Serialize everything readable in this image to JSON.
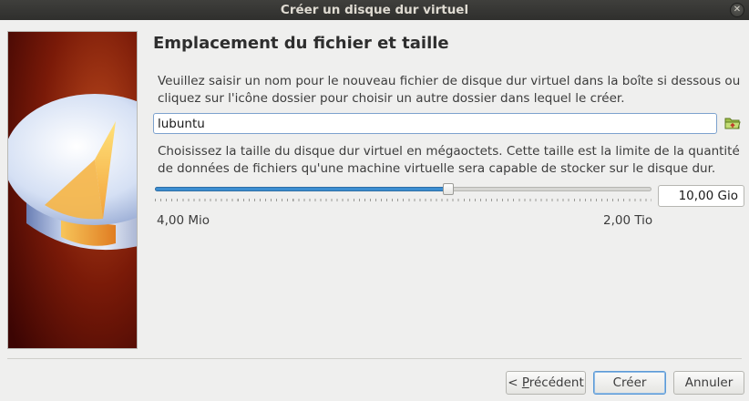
{
  "window": {
    "title": "Créer un disque dur virtuel",
    "close_icon": "close-icon"
  },
  "page": {
    "title": "Emplacement du fichier et taille",
    "location_description": "Veuillez saisir un nom pour le nouveau fichier de disque dur virtuel dans la boîte si dessous ou cliquez sur l'icône dossier pour choisir un autre dossier dans lequel le créer.",
    "file_name_value": "lubuntu",
    "folder_icon": "folder-icon",
    "size_description": "Choisissez la taille du disque dur virtuel en mégaoctets. Cette taille est la limite de la quantité de données de fichiers qu'une machine virtuelle sera capable de stocker sur le disque dur."
  },
  "size": {
    "slider_fraction": 0.59,
    "value": "10,00 Gio",
    "min_label": "4,00 Mio",
    "max_label": "2,00 Tio"
  },
  "buttons": {
    "previous_prefix": "< ",
    "previous_mnemonic": "P",
    "previous_rest": "récédent",
    "create": "Créer",
    "cancel": "Annuler"
  },
  "colors": {
    "accent": "#3c8ed1",
    "title_bar": "#3a3a37",
    "background": "#efefee"
  }
}
